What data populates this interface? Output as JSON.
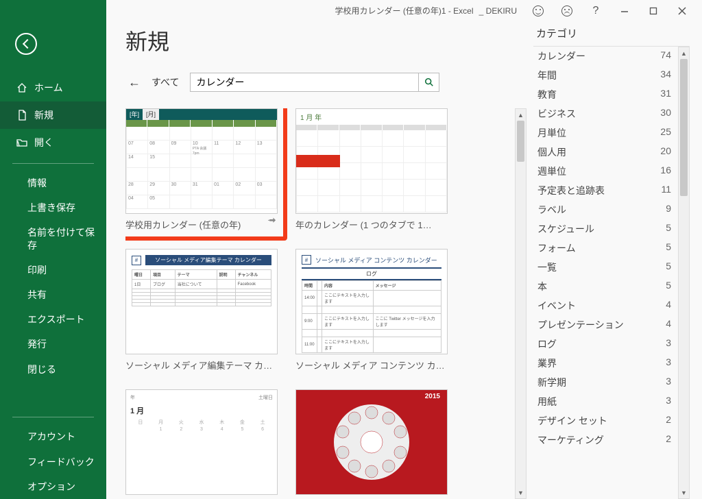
{
  "window": {
    "title": "学校用カレンダー (任意の年)1  -  Excel",
    "user_prefix": "_ ",
    "user": "DEKIRU"
  },
  "sidebar": {
    "home": "ホーム",
    "new": "新規",
    "open": "開く",
    "info": "情報",
    "save": "上書き保存",
    "save_as": "名前を付けて保存",
    "print": "印刷",
    "share": "共有",
    "export": "エクスポート",
    "publish": "発行",
    "close": "閉じる",
    "account": "アカウント",
    "feedback": "フィードバック",
    "options": "オプション"
  },
  "page": {
    "title": "新規",
    "all_label": "すべて",
    "search_value": "カレンダー"
  },
  "templates": [
    {
      "label": "学校用カレンダー (任意の年)",
      "pin": "⊸",
      "year_lbl": "[年]",
      "month_lbl": "[月]"
    },
    {
      "label": "年のカレンダー (1 つのタブで 1…",
      "header": "1 月 年"
    },
    {
      "label": "ソーシャル メディア編集テーマ カレ…",
      "header": "ソーシャル メディア編集テーマ カレンダー"
    },
    {
      "label": "ソーシャル メディア コンテンツ カレ…",
      "header": "ソーシャル メディア コンテンツ カレンダー",
      "sub": "ログ"
    },
    {
      "label": "",
      "header": "1 月"
    },
    {
      "label": "",
      "year": "2015"
    }
  ],
  "categories_title": "カテゴリ",
  "categories": [
    {
      "label": "カレンダー",
      "count": 74
    },
    {
      "label": "年間",
      "count": 34
    },
    {
      "label": "教育",
      "count": 31
    },
    {
      "label": "ビジネス",
      "count": 30
    },
    {
      "label": "月単位",
      "count": 25
    },
    {
      "label": "個人用",
      "count": 20
    },
    {
      "label": "週単位",
      "count": 16
    },
    {
      "label": "予定表と追跡表",
      "count": 11
    },
    {
      "label": "ラベル",
      "count": 9
    },
    {
      "label": "スケジュール",
      "count": 5
    },
    {
      "label": "フォーム",
      "count": 5
    },
    {
      "label": "一覧",
      "count": 5
    },
    {
      "label": "本",
      "count": 5
    },
    {
      "label": "イベント",
      "count": 4
    },
    {
      "label": "プレゼンテーション",
      "count": 4
    },
    {
      "label": "ログ",
      "count": 3
    },
    {
      "label": "業界",
      "count": 3
    },
    {
      "label": "新学期",
      "count": 3
    },
    {
      "label": "用紙",
      "count": 3
    },
    {
      "label": "デザイン セット",
      "count": 2
    },
    {
      "label": "マーケティング",
      "count": 2
    }
  ]
}
